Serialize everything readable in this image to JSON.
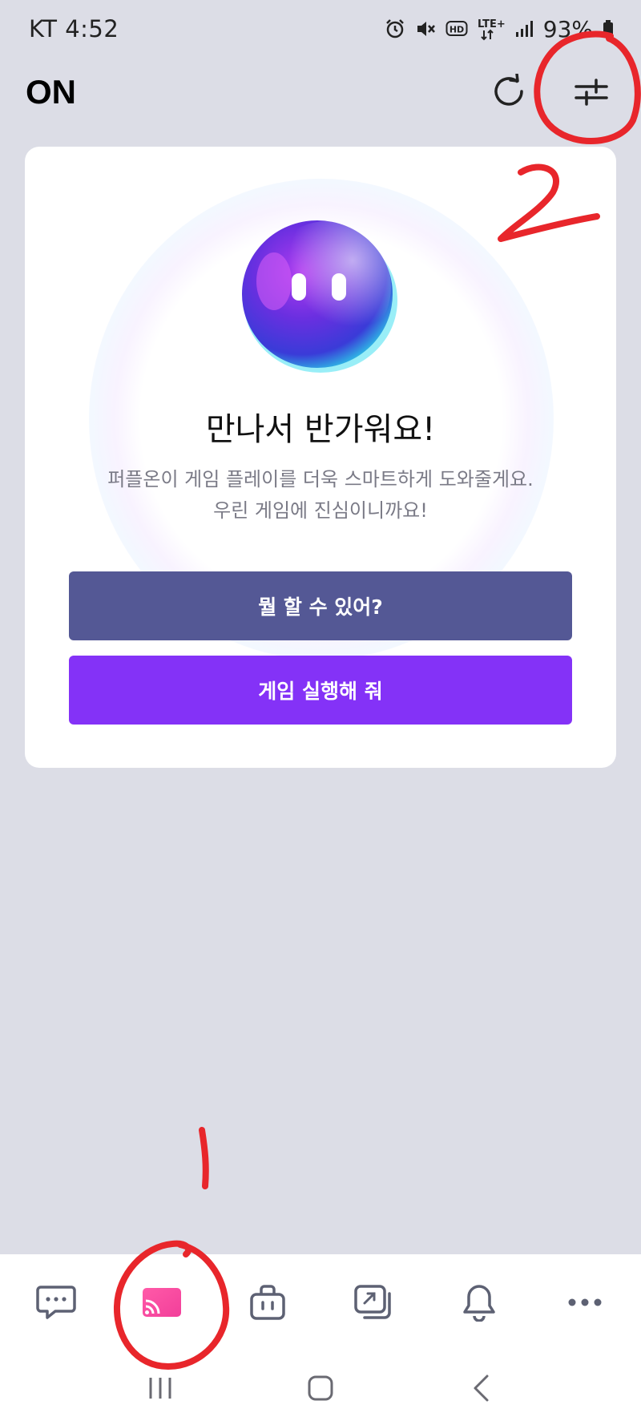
{
  "status_bar": {
    "carrier_time": "KT 4:52",
    "network": "LTE+",
    "battery": "93%",
    "icons": [
      "alarm-icon",
      "mute-icon",
      "hd-icon",
      "lte-icon",
      "signal-icon",
      "battery-icon"
    ]
  },
  "header": {
    "title": "ON",
    "refresh_icon": "refresh-icon",
    "settings_icon": "sliders-icon"
  },
  "card": {
    "title": "만나서 반가워요!",
    "subtitle_line1": "퍼플온이 게임 플레이를 더욱 스마트하게 도와줄게요.",
    "subtitle_line2": "우린 게임에 진심이니까요!",
    "button_what": "뭘 할 수 있어?",
    "button_run": "게임 실행해 줘"
  },
  "bottom_nav": {
    "items": [
      {
        "icon": "chat-icon",
        "active": false
      },
      {
        "icon": "cast-icon",
        "active": true
      },
      {
        "icon": "shop-bag-icon",
        "active": false
      },
      {
        "icon": "screens-icon",
        "active": false
      },
      {
        "icon": "bell-icon",
        "active": false
      },
      {
        "icon": "more-icon",
        "active": false
      }
    ]
  },
  "system_nav": {
    "icons": [
      "recent-apps-icon",
      "home-icon",
      "back-icon"
    ]
  },
  "annotations": {
    "labels": [
      "1",
      "2"
    ],
    "color": "#e8262b"
  },
  "colors": {
    "background": "#dcdde6",
    "button_what": "#545895",
    "button_run": "#8432f7",
    "active_nav": "#f0479a"
  }
}
